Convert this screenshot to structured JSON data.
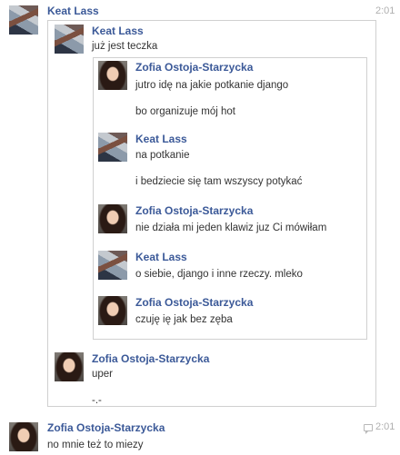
{
  "outer_top": {
    "author": "Keat Lass",
    "time": "2:01",
    "quote": {
      "author": "Keat Lass",
      "text": "już jest teczka",
      "nested": [
        {
          "author": "Zofia Ostoja-Starzycka",
          "lines": [
            "jutro idę na jakie potkanie django",
            "bo organizuje mój hot"
          ]
        },
        {
          "author": "Keat Lass",
          "lines": [
            "na potkanie",
            "i bedziecie się tam wszyscy potykać"
          ]
        },
        {
          "author": "Zofia Ostoja-Starzycka",
          "lines": [
            "nie działa mi jeden klawiz juz Ci mówiłam"
          ]
        },
        {
          "author": "Keat Lass",
          "lines": [
            "o siebie, django i inne rzeczy. mleko"
          ]
        },
        {
          "author": "Zofia Ostoja-Starzycka",
          "lines": [
            "czuję ię jak bez zęba"
          ]
        }
      ],
      "reply": {
        "author": "Zofia Ostoja-Starzycka",
        "lines": [
          "uper",
          "-.-"
        ]
      }
    }
  },
  "outer_bottom": {
    "author": "Zofia Ostoja-Starzycka",
    "time": "2:01",
    "text": "no mnie też to miezy"
  },
  "colors": {
    "name": "#3b5998",
    "text": "#333333",
    "border": "#d0d0d0",
    "time": "#b0b0b0"
  },
  "icons": [
    "avatar-keat",
    "avatar-zofia",
    "quote-icon"
  ]
}
